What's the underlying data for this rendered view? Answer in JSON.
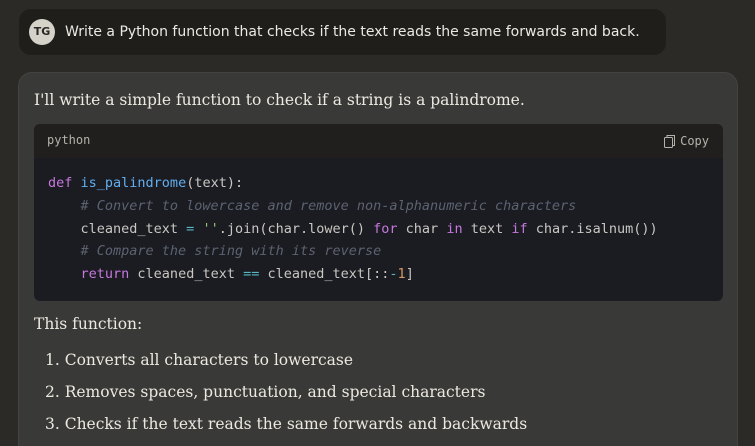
{
  "user_message": {
    "avatar_initials": "TG",
    "text": "Write a Python function that checks if the text reads the same forwards and back."
  },
  "assistant": {
    "intro": "I'll write a simple function to check if a string is a palindrome.",
    "code_block": {
      "language": "python",
      "copy_label": "Copy",
      "code": "def is_palindrome(text):\n    # Convert to lowercase and remove non-alphanumeric characters\n    cleaned_text = ''.join(char.lower() for char in text if char.isalnum())\n    # Compare the string with its reverse\n    return cleaned_text == cleaned_text[::-1]",
      "icon": "copy-icon"
    },
    "summary_intro": "This function:",
    "summary_items": [
      "1. Converts all characters to lowercase",
      "2. Removes spaces, punctuation, and special characters",
      "3. Checks if the text reads the same forwards and backwards"
    ]
  },
  "colors": {
    "background": "#2b2a27",
    "user_bubble": "#1f1e1b",
    "assistant_card": "#393937",
    "code_background": "#1b1b22",
    "code_header": "#201f1d"
  }
}
